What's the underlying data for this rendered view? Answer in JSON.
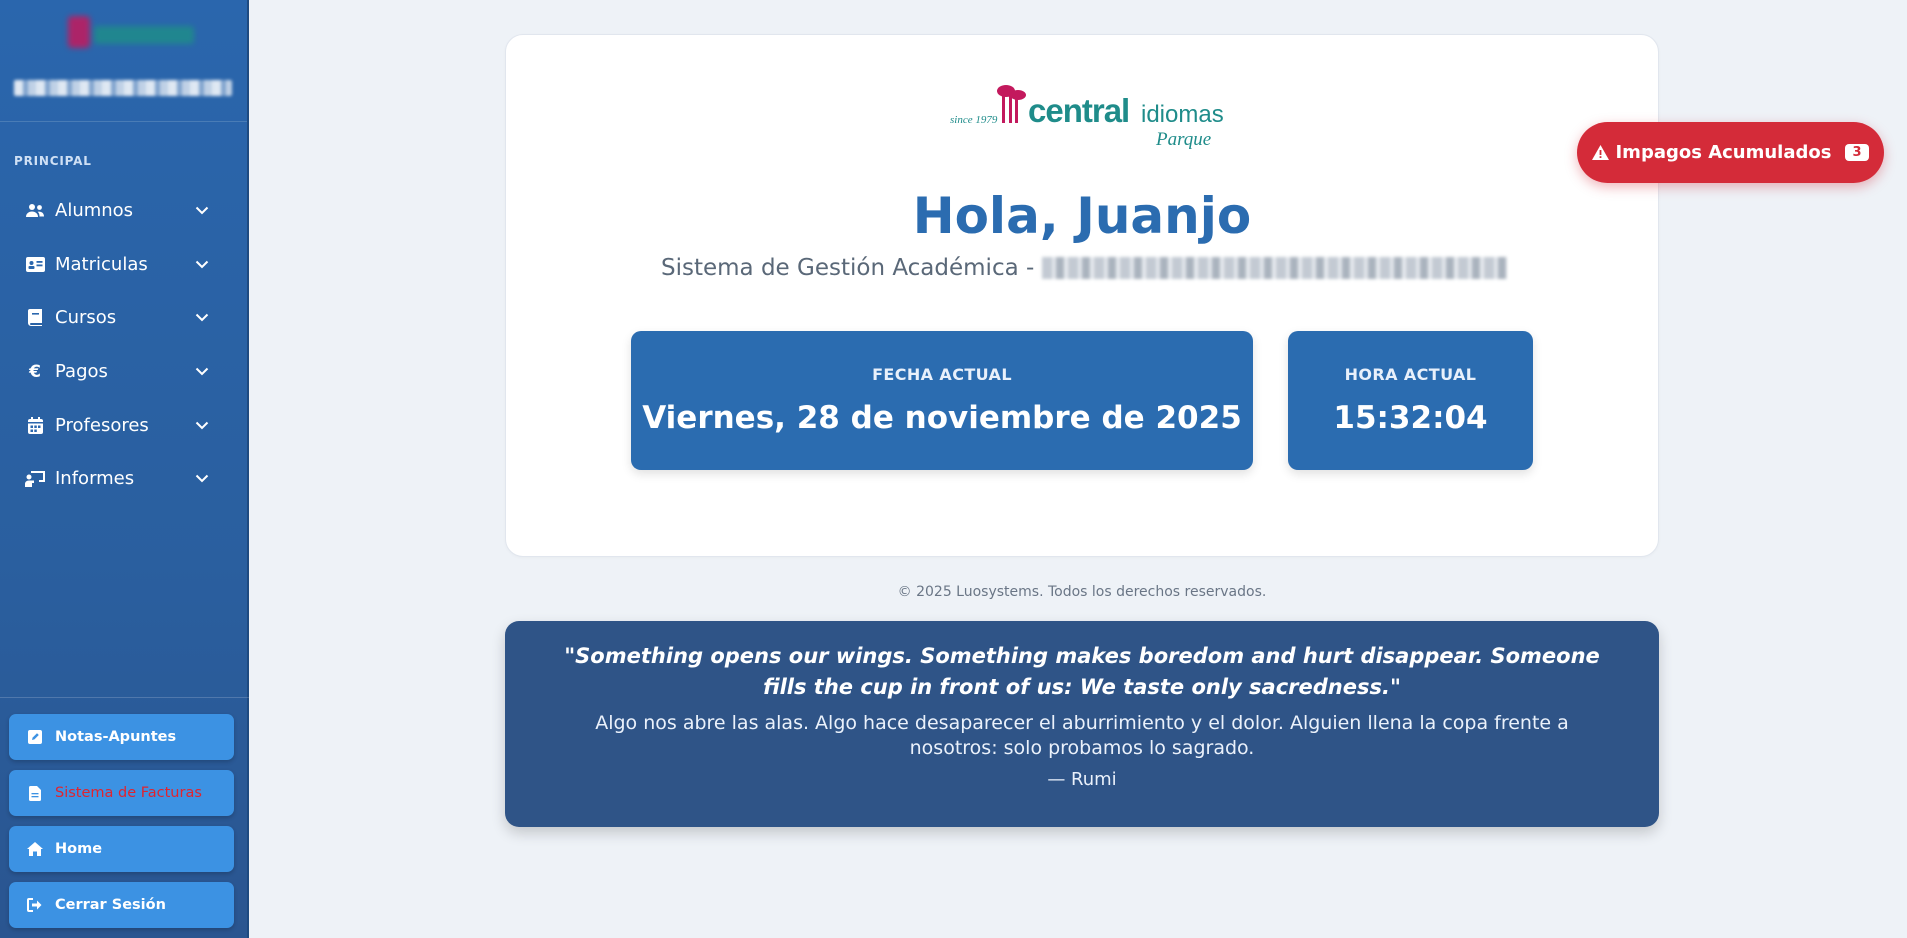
{
  "sidebar": {
    "section_label": "PRINCIPAL",
    "items": [
      {
        "label": "Alumnos",
        "icon": "users-icon"
      },
      {
        "label": "Matriculas",
        "icon": "id-card-icon"
      },
      {
        "label": "Cursos",
        "icon": "book-icon"
      },
      {
        "label": "Pagos",
        "icon": "euro-icon"
      },
      {
        "label": "Profesores",
        "icon": "calendar-icon"
      },
      {
        "label": "Informes",
        "icon": "chalkboard-user-icon"
      }
    ],
    "bottom_buttons": [
      {
        "label": "Notas-Apuntes",
        "icon": "pen-square-icon"
      },
      {
        "label": "Sistema de Facturas",
        "icon": "file-icon"
      },
      {
        "label": "Home",
        "icon": "home-icon"
      },
      {
        "label": "Cerrar Sesión",
        "icon": "sign-out-icon"
      }
    ]
  },
  "main": {
    "logo": {
      "since": "since 1979",
      "word1": "central",
      "word2": "idiomas",
      "word3": "Parque"
    },
    "greeting": "Hola, Juanjo",
    "subtitle": "Sistema de Gestión Académica -",
    "date_caption": "FECHA ACTUAL",
    "date_value": "Viernes, 28 de noviembre de 2025",
    "time_caption": "HORA ACTUAL",
    "time_value": "15:32:04"
  },
  "footer": "© 2025 Luosystems. Todos los derechos reservados.",
  "quote": {
    "english": "\"Something opens our wings. Something makes boredom and hurt disappear. Someone fills the cup in front of us: We taste only sacredness.\"",
    "spanish": "Algo nos abre las alas. Algo hace desaparecer el aburrimiento y el dolor. Alguien llena la copa frente a nosotros: solo probamos lo sagrado.",
    "author": "— Rumi"
  },
  "alert": {
    "label": "Impagos Acumulados",
    "count": "3"
  },
  "colors": {
    "sidebar": "#2a66ad",
    "primary": "#2b6cb0",
    "quote_bg": "#2f5487",
    "alert": "#d42b39",
    "button": "#3c92e3"
  }
}
